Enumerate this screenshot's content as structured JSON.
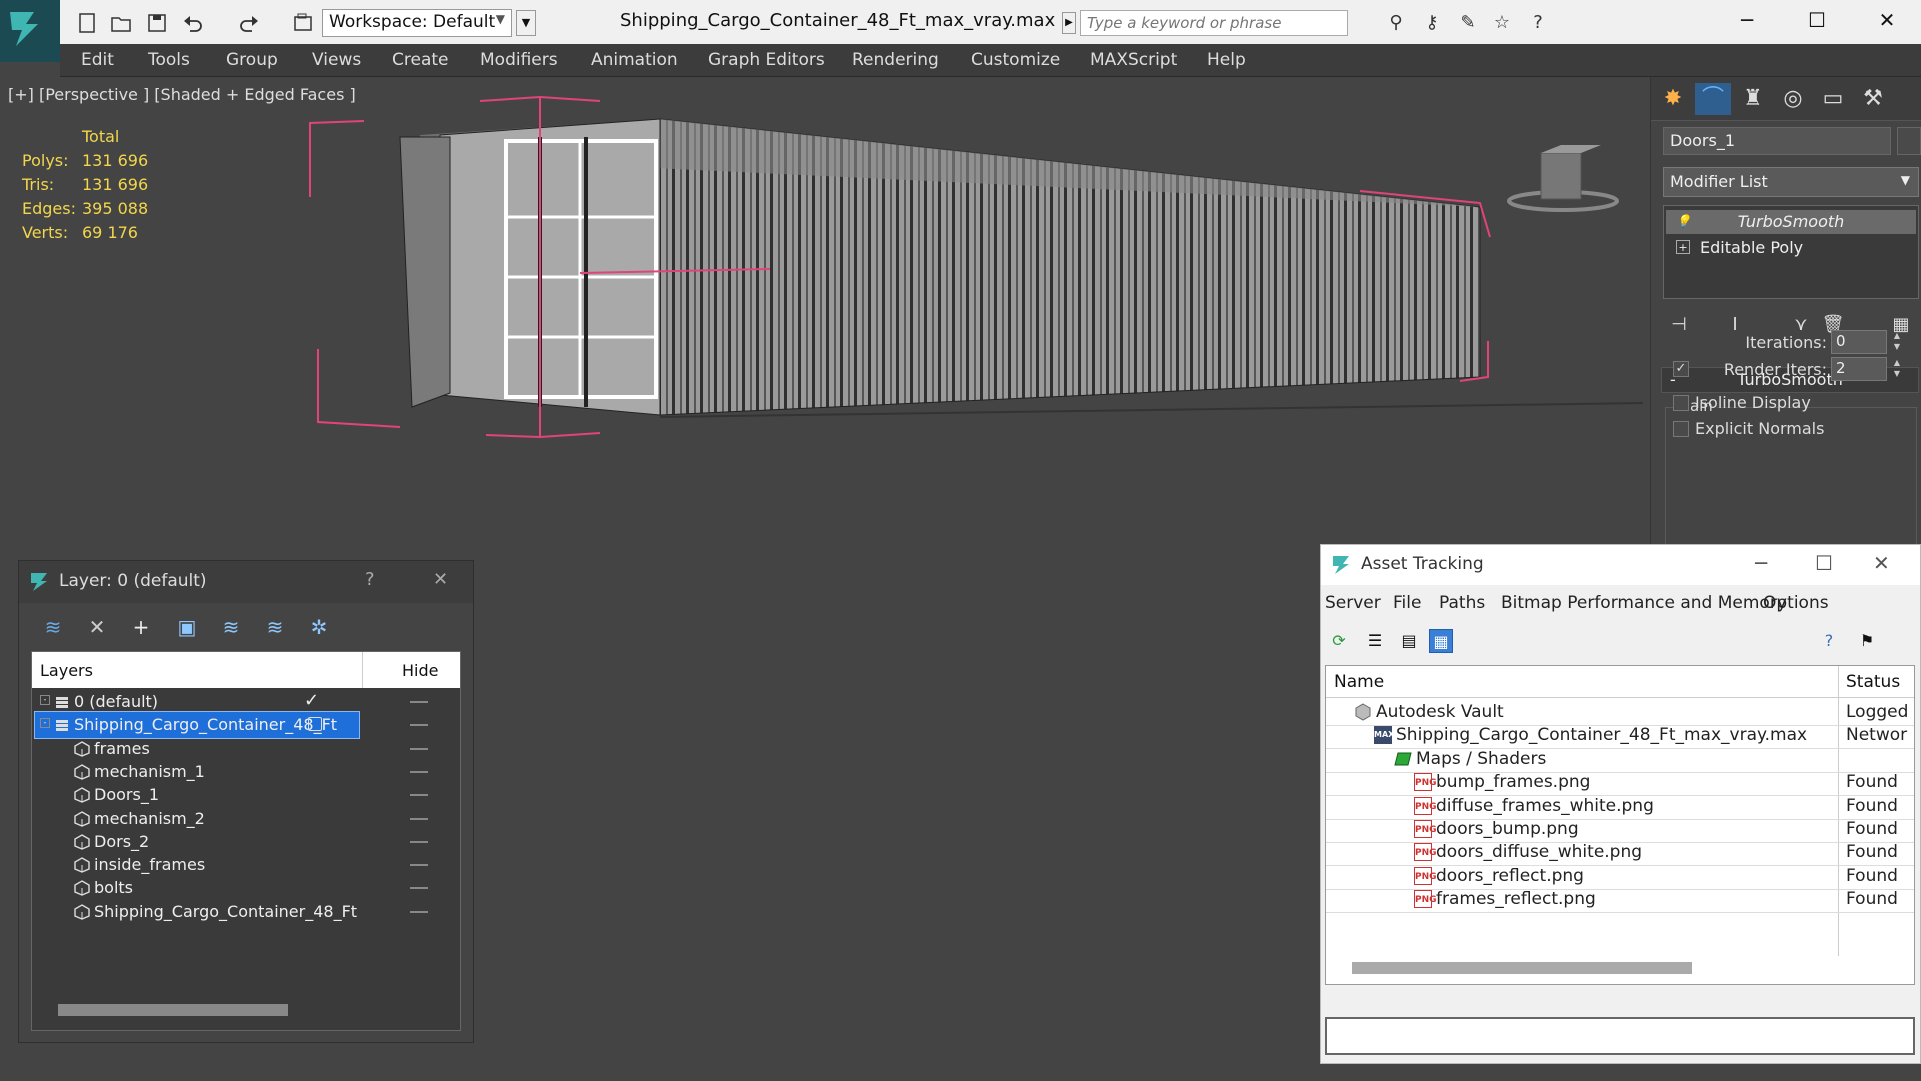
{
  "app": {
    "title": "Shipping_Cargo_Container_48_Ft_max_vray.max",
    "workspace": "Workspace: Default",
    "search_placeholder": "Type a keyword or phrase",
    "accent": "#1e6fd9"
  },
  "menu": [
    "Edit",
    "Tools",
    "Group",
    "Views",
    "Create",
    "Modifiers",
    "Animation",
    "Graph Editors",
    "Rendering",
    "Customize",
    "MAXScript",
    "Help"
  ],
  "viewport": {
    "label": "[+] [Perspective ] [Shaded + Edged Faces ]",
    "stats": {
      "header": "Total",
      "rows": [
        {
          "label": "Polys:",
          "value": "131 696"
        },
        {
          "label": "Tris:",
          "value": "131 696"
        },
        {
          "label": "Edges:",
          "value": "395 088"
        },
        {
          "label": "Verts:",
          "value": "69 176"
        }
      ]
    }
  },
  "command_panel": {
    "object_name": "Doors_1",
    "modifier_list": "Modifier List",
    "stack": [
      "TurboSmooth",
      "Editable Poly"
    ],
    "rollout": "TurboSmooth",
    "group": "Main",
    "iterations_label": "Iterations:",
    "iterations_value": "0",
    "render_iters_label": "Render Iters:",
    "render_iters_value": "2",
    "isoline_label": "Isoline Display",
    "explicit_normals_label": "Explicit Normals"
  },
  "layer_dialog": {
    "title": "Layer: 0 (default)",
    "help": "?",
    "col_layers": "Layers",
    "col_hide": "Hide",
    "rows": [
      {
        "name": "0 (default)",
        "level": 1
      },
      {
        "name": "Shipping_Cargo_Container_48_Ft",
        "level": 1,
        "selected": true
      },
      {
        "name": "frames",
        "level": 2
      },
      {
        "name": "mechanism_1",
        "level": 2
      },
      {
        "name": "Doors_1",
        "level": 2
      },
      {
        "name": "mechanism_2",
        "level": 2
      },
      {
        "name": "Dors_2",
        "level": 2
      },
      {
        "name": "inside_frames",
        "level": 2
      },
      {
        "name": "bolts",
        "level": 2
      },
      {
        "name": "Shipping_Cargo_Container_48_Ft",
        "level": 2
      }
    ]
  },
  "asset_dialog": {
    "title": "Asset Tracking",
    "menu": [
      "Server",
      "File",
      "Paths",
      "Bitmap Performance and Memory",
      "Options"
    ],
    "col_name": "Name",
    "col_status": "Status",
    "rows": [
      {
        "name": "Autodesk Vault",
        "status": "Logged",
        "level": 1,
        "icon": "vault"
      },
      {
        "name": "Shipping_Cargo_Container_48_Ft_max_vray.max",
        "status": "Networ",
        "level": 2,
        "icon": "max"
      },
      {
        "name": "Maps / Shaders",
        "status": "",
        "level": 3,
        "icon": "maps"
      },
      {
        "name": "bump_frames.png",
        "status": "Found",
        "level": 4,
        "icon": "png"
      },
      {
        "name": "diffuse_frames_white.png",
        "status": "Found",
        "level": 4,
        "icon": "png"
      },
      {
        "name": "doors_bump.png",
        "status": "Found",
        "level": 4,
        "icon": "png"
      },
      {
        "name": "doors_diffuse_white.png",
        "status": "Found",
        "level": 4,
        "icon": "png"
      },
      {
        "name": "doors_reflect.png",
        "status": "Found",
        "level": 4,
        "icon": "png"
      },
      {
        "name": "frames_reflect.png",
        "status": "Found",
        "level": 4,
        "icon": "png"
      }
    ],
    "png_badge": "PNG",
    "max_badge": "MAX"
  }
}
